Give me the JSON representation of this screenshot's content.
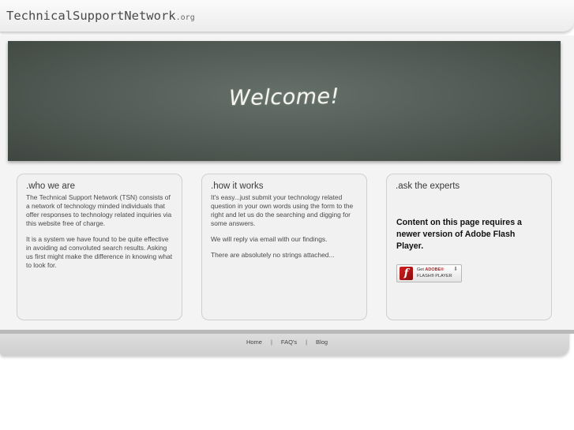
{
  "header": {
    "logo_main": "TechnicalSupportNetwork",
    "logo_suffix": ".org"
  },
  "banner": {
    "title": "Welcome!"
  },
  "boxes": [
    {
      "heading": ".who we are",
      "paragraphs": [
        "The Technical Support Network (TSN) consists of a network of technology minded individuals that offer responses to technology related inquiries via this website free of charge.",
        "It is a system we have found to be quite effective in avoiding ad convoluted search results. Asking us first might make the difference in knowing what to look for."
      ]
    },
    {
      "heading": ".how it works",
      "paragraphs": [
        "It's easy...just submit your technology related question in your own words using the form to the right and let us do the searching and digging for some answers.",
        "We will reply via email with our findings.",
        "There are absolutely no strings attached..."
      ]
    },
    {
      "heading": ".ask the experts",
      "flash_message": "Content on this page requires a newer version of Adobe Flash Player.",
      "flash_badge": {
        "icon_letter": "f",
        "line1_prefix": "Get ",
        "line1_brand": "ADOBE®",
        "line2": "FLASH® PLAYER"
      }
    }
  ],
  "footer": {
    "links": [
      "Home",
      "FAQ's",
      "Blog"
    ],
    "separator": "|"
  }
}
